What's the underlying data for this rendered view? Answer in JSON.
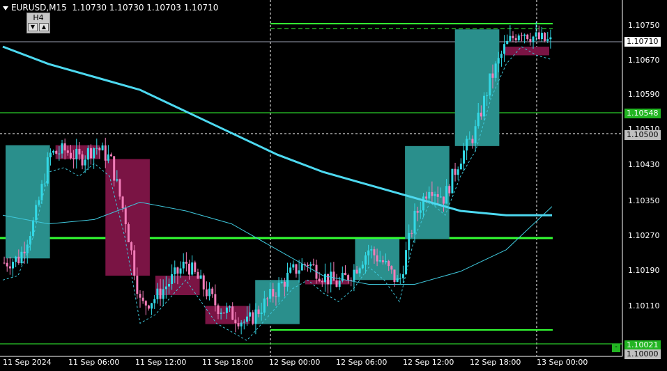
{
  "header": {
    "symbol": "EURUSD,M15",
    "ohlc": "1.10730 1.10730 1.10703 1.10710"
  },
  "timeframe": {
    "label": "H4",
    "down_label": "▼",
    "up_label": "▲"
  },
  "mini_button": {
    "label": "-"
  },
  "colors": {
    "background": "#000000",
    "bull_candle": "#33d9e6",
    "bear_candle": "#f27cb8",
    "bull_box": "#2a8f8c",
    "bear_box": "#7a1444",
    "ma_slow": "#4dd9f0",
    "ma_fast": "#3fc8dc",
    "level_line": "#33ff33",
    "grid_line": "#ffffff"
  },
  "y_axis": {
    "ticks": [
      "1.10750",
      "1.10670",
      "1.10590",
      "1.10510",
      "1.10430",
      "1.10350",
      "1.10270",
      "1.10190",
      "1.10110",
      "1.10030",
      "1.10000"
    ]
  },
  "price_tags": {
    "current": "1.10710",
    "level_high": "1.10548",
    "level_mid": "1.10500",
    "level_low": "1.10021",
    "bottom": "1.10000"
  },
  "x_axis": {
    "labels": [
      "11 Sep 2024",
      "11 Sep 06:00",
      "11 Sep 12:00",
      "11 Sep 18:00",
      "12 Sep 00:00",
      "12 Sep 06:00",
      "12 Sep 12:00",
      "12 Sep 18:00",
      "13 Sep 00:00"
    ]
  },
  "chart_data": {
    "type": "candlestick",
    "symbol": "EURUSD",
    "timeframe": "M15",
    "overlay_timeframe": "H4",
    "ylim": [
      1.0996,
      1.108
    ],
    "horizontal_levels": [
      1.10762,
      1.1074,
      1.10548,
      1.105,
      1.10262,
      1.10047,
      1.10021
    ],
    "current_price": 1.1071,
    "h4_boxes": [
      {
        "open": 1.1021,
        "close": 1.10472,
        "high": 1.1052,
        "low": 1.1018,
        "dir": "bull"
      },
      {
        "open": 1.10472,
        "close": 1.1044,
        "high": 1.1052,
        "low": 1.1042,
        "dir": "bear"
      },
      {
        "open": 1.1044,
        "close": 1.1017,
        "high": 1.1053,
        "low": 1.1006,
        "dir": "bear"
      },
      {
        "open": 1.1017,
        "close": 1.10125,
        "high": 1.1025,
        "low": 1.1005,
        "dir": "bear"
      },
      {
        "open": 1.101,
        "close": 1.10058,
        "high": 1.1013,
        "low": 1.1004,
        "dir": "bear"
      },
      {
        "open": 1.10058,
        "close": 1.1016,
        "high": 1.1018,
        "low": 1.1004,
        "dir": "bull"
      },
      {
        "open": 1.1016,
        "close": 1.1015,
        "high": 1.1023,
        "low": 1.1011,
        "dir": "bear"
      },
      {
        "open": 1.1016,
        "close": 1.10255,
        "high": 1.1032,
        "low": 1.1013,
        "dir": "bull"
      },
      {
        "open": 1.10255,
        "close": 1.1047,
        "high": 1.1049,
        "low": 1.1012,
        "dir": "bull"
      },
      {
        "open": 1.1047,
        "close": 1.1074,
        "high": 1.1075,
        "low": 1.1044,
        "dir": "bull"
      },
      {
        "open": 1.107,
        "close": 1.1068,
        "high": 1.1076,
        "low": 1.1066,
        "dir": "bear"
      }
    ],
    "moving_average_slow": [
      1.107,
      1.1066,
      1.1063,
      1.106,
      1.1055,
      1.105,
      1.1045,
      1.1041,
      1.1038,
      1.1035,
      1.1032,
      1.1031,
      1.1031
    ],
    "moving_average_fast": [
      1.1031,
      1.1029,
      1.103,
      1.1034,
      1.1032,
      1.1029,
      1.1023,
      1.1017,
      1.1015,
      1.1015,
      1.1018,
      1.1023,
      1.1033
    ],
    "close_path": [
      1.102,
      1.1021,
      1.103,
      1.1045,
      1.1046,
      1.1044,
      1.1047,
      1.1044,
      1.103,
      1.101,
      1.1012,
      1.1016,
      1.102,
      1.1015,
      1.101,
      1.1008,
      1.1006,
      1.101,
      1.1014,
      1.1018,
      1.102,
      1.1017,
      1.1015,
      1.1018,
      1.1023,
      1.102,
      1.1015,
      1.103,
      1.1038,
      1.1035,
      1.1044,
      1.105,
      1.1062,
      1.107,
      1.1074,
      1.1072,
      1.1071
    ]
  }
}
